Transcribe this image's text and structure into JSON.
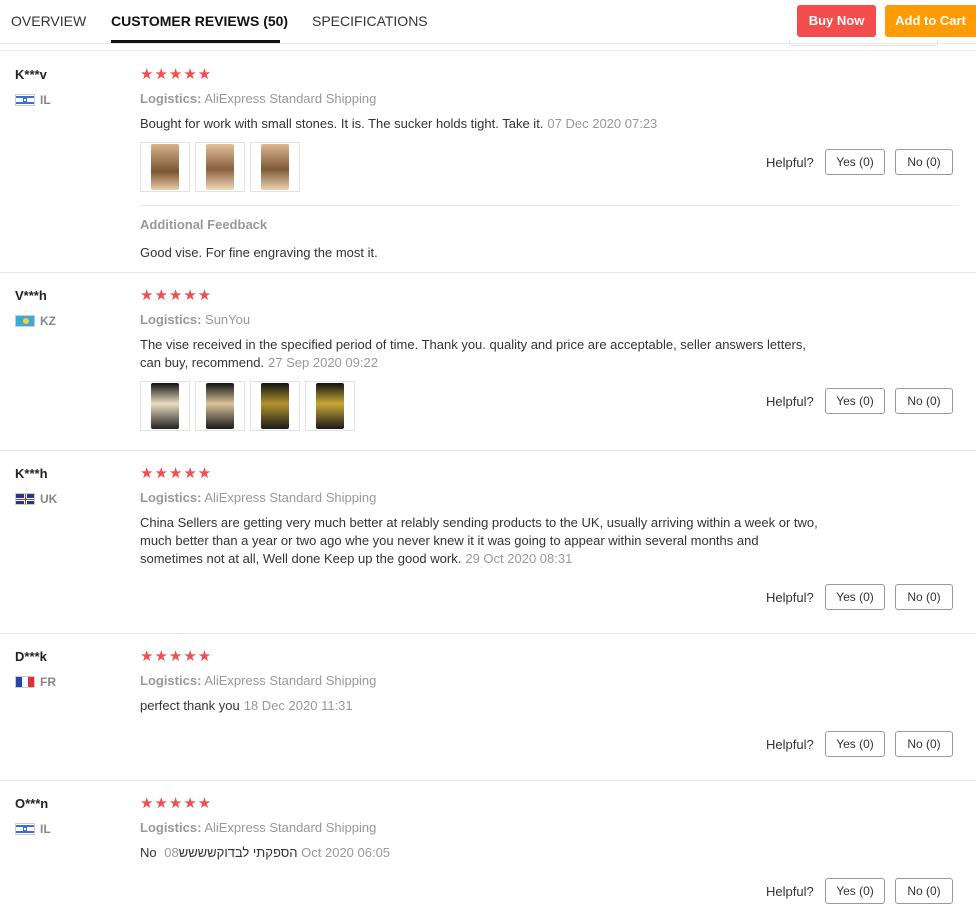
{
  "tabs": [
    {
      "label": "OVERVIEW"
    },
    {
      "label": "CUSTOMER REVIEWS (50)"
    },
    {
      "label": "SPECIFICATIONS"
    }
  ],
  "actions": {
    "buy_now": "Buy Now",
    "add_to_cart": "Add to Cart"
  },
  "labels": {
    "logistics": "Logistics:",
    "helpful": "Helpful?",
    "yes": "Yes (0)",
    "no": "No (0)",
    "stars": "★★★★★",
    "additional_feedback": "Additional Feedback"
  },
  "reviews": [
    {
      "name": "K***v",
      "country": "IL",
      "flag": "israel-flag-icon",
      "rating": 5,
      "logistics": "AliExpress Standard Shipping",
      "text": "Bought for work with small stones. It is. The sucker holds tight. Take it.",
      "date": "07 Dec 2020 07:23",
      "photos": 3,
      "additional_feedback": "Good vise. For fine engraving the most it."
    },
    {
      "name": "V***h",
      "country": "KZ",
      "flag": "kazakhstan-flag-icon",
      "rating": 5,
      "logistics": "SunYou",
      "text_line1": "The vise received in the specified period of time. Thank you. quality and price are acceptable, seller answers letters,",
      "text_line2": "can buy, recommend.",
      "date": "27 Sep 2020 09:22",
      "photos": 4
    },
    {
      "name": "K***h",
      "country": "UK",
      "flag": "uk-flag-icon",
      "rating": 5,
      "logistics": "AliExpress Standard Shipping",
      "text_line1": "China Sellers are getting very much better at relably sending products to the UK, usually arriving within a week or two,",
      "text_line2": "much better than a year or two ago whe you never knew it it was going to appear within several months and",
      "text_line3": "sometimes not at all, Well done Keep up the good work.",
      "date": "29 Oct 2020 08:31"
    },
    {
      "name": "D***k",
      "country": "FR",
      "flag": "france-flag-icon",
      "rating": 5,
      "logistics": "AliExpress Standard Shipping",
      "text": "perfect thank you",
      "date": "18 Dec 2020 11:31"
    },
    {
      "name": "O***n",
      "country": "IL",
      "flag": "israel-flag-icon",
      "rating": 5,
      "logistics": "AliExpress Standard Shipping",
      "text": "No הספקתי לבדוקשששש",
      "date": "08 Oct 2020 06:05"
    }
  ],
  "colors": {
    "accent_red": "#f44d4d",
    "accent_orange": "#ff9b05",
    "stars": "#f44d4d",
    "muted": "#999999"
  }
}
